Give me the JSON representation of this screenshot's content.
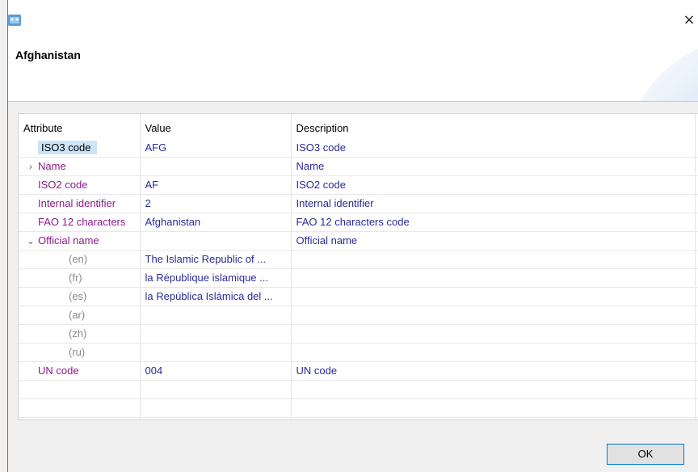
{
  "dialog": {
    "title": "Afghanistan",
    "ok_label": "OK",
    "close_glyph": "×"
  },
  "table": {
    "headers": [
      "Attribute",
      "Value",
      "Description"
    ],
    "rows": [
      {
        "attr": "ISO3 code",
        "value": "AFG",
        "desc": "ISO3 code",
        "selected": true
      },
      {
        "attr": "Name",
        "value": "",
        "desc": "Name",
        "expander": "›"
      },
      {
        "attr": "ISO2 code",
        "value": "AF",
        "desc": "ISO2 code"
      },
      {
        "attr": "Internal identifier",
        "value": "2",
        "desc": "Internal identifier"
      },
      {
        "attr": "FAO 12 characters",
        "value": "Afghanistan",
        "desc": "FAO 12 characters code"
      },
      {
        "attr": "Official name",
        "value": "",
        "desc": "Official name",
        "expander": "⌄"
      },
      {
        "attr": "(en)",
        "value": "The Islamic Republic of ...",
        "desc": "",
        "sub": true
      },
      {
        "attr": "(fr)",
        "value": "la République islamique ...",
        "desc": "",
        "sub": true
      },
      {
        "attr": "(es)",
        "value": "la República Islámica del ...",
        "desc": "",
        "sub": true
      },
      {
        "attr": "(ar)",
        "value": "",
        "desc": "",
        "sub": true
      },
      {
        "attr": "(zh)",
        "value": "",
        "desc": "",
        "sub": true
      },
      {
        "attr": "(ru)",
        "value": "",
        "desc": "",
        "sub": true
      },
      {
        "attr": "UN code",
        "value": "004",
        "desc": "UN code"
      }
    ]
  },
  "colors": {
    "attribute_text": "#8b1a8b",
    "value_text": "#2a2a9a",
    "sub_attribute_text": "#8a8a8a",
    "selection": "#cce4f7",
    "ok_border": "#0078d7"
  },
  "icons": {
    "app": "window-app-icon",
    "close": "close-icon"
  }
}
